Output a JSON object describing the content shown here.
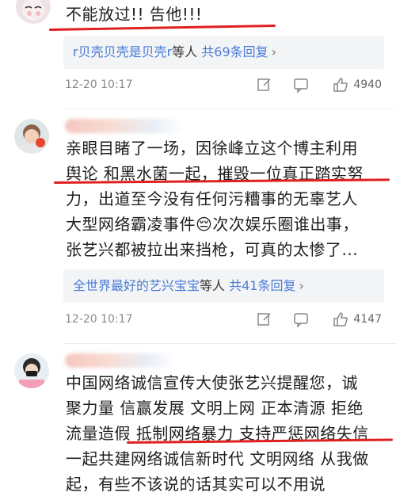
{
  "comments": [
    {
      "text_lines": [
        "不能放过!! 告他!!!"
      ],
      "reply_user": "r贝壳贝壳是贝壳r",
      "reply_mid": "等人 ",
      "reply_count": "共69条回复",
      "reply_arrow": "›",
      "time": "12-20 10:17",
      "likes": "4940"
    },
    {
      "text_lines": [
        "亲眼目睹了一场，因徐峰立这个博主利用",
        "舆论 和黑水菌一起，摧毁一位真正踏实努",
        "力，出道至今没有任何污糟事的无辜艺人",
        "大型网络霸凌事件😔次次娱乐圈谁出事，",
        "张艺兴都被拉出来挡枪，可真的太惨了..."
      ],
      "reply_user": "全世界最好的艺兴宝宝",
      "reply_mid": "等人 ",
      "reply_count": "共41条回复",
      "reply_arrow": "›",
      "time": "12-20 10:17",
      "likes": "4147"
    },
    {
      "text_lines": [
        "中国网络诚信宣传大使张艺兴提醒您，诚",
        "聚力量 信赢发展 文明上网 正本清源 拒绝",
        "流量造假 抵制网络暴力 支持严惩网络失信",
        "一起共建网络诚信新时代 文明网络 从我做",
        "起，有些不该说的话其实可以不用说"
      ]
    }
  ],
  "colors": {
    "accent_blue": "#4a7bd6",
    "highlight_red": "#e02020",
    "reply_bg": "#f3f4f6"
  },
  "icons": [
    "edit-icon",
    "comment-icon",
    "thumbs-up-icon"
  ]
}
